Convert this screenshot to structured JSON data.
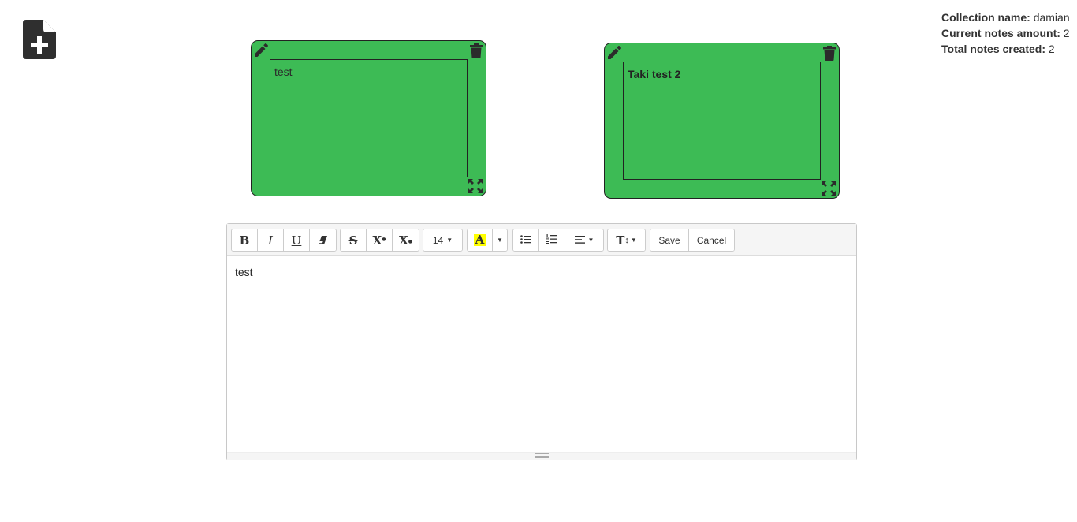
{
  "stats": {
    "collection_label": "Collection name:",
    "collection_value": "damian",
    "current_label": "Current notes amount:",
    "current_value": "2",
    "total_label": "Total notes created:",
    "total_value": "2"
  },
  "notes": [
    {
      "text": "test",
      "edit_icon": "pencil-icon",
      "delete_icon": "trash-icon",
      "expand_icon": "expand-icon"
    },
    {
      "text": "Taki test 2",
      "edit_icon": "pencil-icon",
      "delete_icon": "trash-icon",
      "expand_icon": "expand-icon"
    }
  ],
  "note_color": "#3dbb55",
  "editor": {
    "content": "test",
    "toolbar": {
      "bold": "B",
      "italic": "I",
      "underline": "U",
      "strikethrough": "S",
      "superscript": "X",
      "subscript": "X",
      "font_size": "14",
      "highlight_letter": "A",
      "highlight_color": "#ffff00",
      "line_height": "T",
      "save": "Save",
      "cancel": "Cancel"
    }
  }
}
